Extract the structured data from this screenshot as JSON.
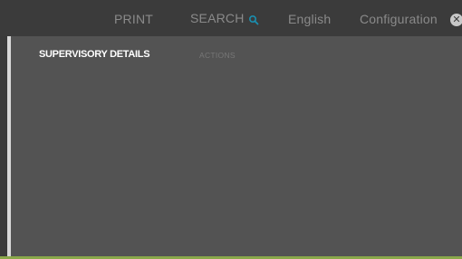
{
  "topbar": {
    "print_label": "PRINT",
    "search_label": "SEARCH",
    "language_label": "English",
    "configuration_label": "Configuration",
    "close_glyph": "✕"
  },
  "icons": {
    "search": "search-icon",
    "close": "close-icon"
  },
  "tabs": [
    {
      "label": "SUPERVISORY DETAILS",
      "active": true
    },
    {
      "label": "ACTIONS",
      "active": false
    }
  ],
  "colors": {
    "accent": "#1a8fb0",
    "panel": "#535353",
    "bottom_bar": "#8aa84a"
  }
}
